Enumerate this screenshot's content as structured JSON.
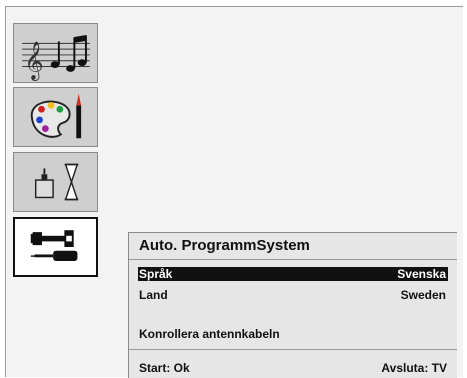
{
  "sidebar": {
    "items": [
      {
        "icon": "music-notes-icon",
        "active": false
      },
      {
        "icon": "palette-icon",
        "active": false
      },
      {
        "icon": "timer-hourglass-icon",
        "active": false
      },
      {
        "icon": "wrench-screwdriver-icon",
        "active": true
      }
    ]
  },
  "menu": {
    "title": "Auto. ProgrammSystem",
    "rows": [
      {
        "label": "Språk",
        "value": "Svenska",
        "selected": true
      },
      {
        "label": "Land",
        "value": "Sweden",
        "selected": false
      }
    ],
    "message": "Konrollera antennkabeln",
    "footer": {
      "start": "Start: Ok",
      "exit": "Avsluta: TV"
    }
  },
  "colors": {
    "highlight_bg": "#111111",
    "highlight_text": "#ffffff",
    "panel_bg": "#e6e6e6",
    "tile_bg": "#cfcfcf"
  }
}
